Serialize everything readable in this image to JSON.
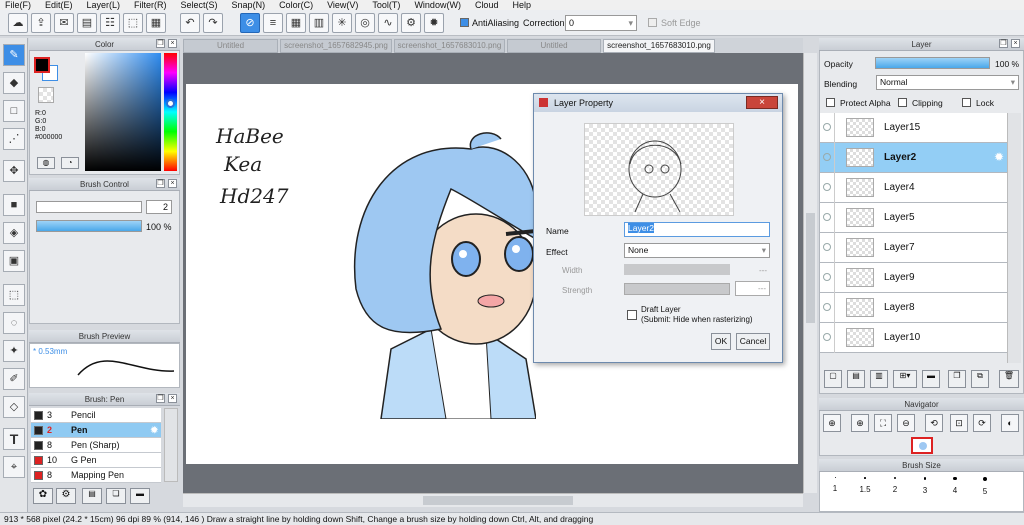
{
  "menu": [
    "File(F)",
    "Edit(E)",
    "Layer(L)",
    "Filter(R)",
    "Select(S)",
    "Snap(N)",
    "Color(C)",
    "View(V)",
    "Tool(T)",
    "Window(W)",
    "Cloud",
    "Help"
  ],
  "toolbar": {
    "antialiasing_label": "AntiAliasing",
    "correction_label": "Correction",
    "correction_value": "0",
    "soft_edge_label": "Soft Edge"
  },
  "color_panel": {
    "title": "Color",
    "r": "R:0",
    "g": "G:0",
    "b": "B:0",
    "hex": "#000000"
  },
  "brush_control": {
    "title": "Brush Control",
    "size": "2",
    "opacity": "100 %",
    "opacity_fill": 1.0
  },
  "brush_preview": {
    "title": "Brush Preview",
    "size": "* 0.53mm"
  },
  "brush_list": {
    "title": "Brush: Pen",
    "items": [
      {
        "size": "3",
        "name": "Pencil",
        "color": "#222222"
      },
      {
        "size": "2",
        "name": "Pen",
        "color": "#222222",
        "selected": true
      },
      {
        "size": "8",
        "name": "Pen (Sharp)",
        "color": "#222222"
      },
      {
        "size": "10",
        "name": "G Pen",
        "color": "#dd2222"
      },
      {
        "size": "8",
        "name": "Mapping Pen",
        "color": "#dd2222"
      }
    ]
  },
  "tabs": [
    "Untitled",
    "screenshot_1657682945.png",
    "screenshot_1657683010.png",
    "Untitled",
    "screenshot_1657683010.png"
  ],
  "active_tab": 4,
  "canvas_text": [
    "HaBee",
    "Kea",
    "Hd247"
  ],
  "dialog": {
    "title": "Layer Property",
    "name_label": "Name",
    "name_value": "Layer2",
    "effect_label": "Effect",
    "effect_value": "None",
    "width_label": "Width",
    "width_dash": "---",
    "strength_label": "Strength",
    "strength_dash": "---",
    "draft_label": "Draft Layer",
    "draft_note": "(Submit: Hide when rasterizing)",
    "ok": "OK",
    "cancel": "Cancel"
  },
  "layer_panel": {
    "title": "Layer",
    "opacity_label": "Opacity",
    "opacity_value": "100 %",
    "opacity_fill": 1.0,
    "blending_label": "Blending",
    "blending_value": "Normal",
    "protect_alpha": "Protect Alpha",
    "clipping": "Clipping",
    "lock": "Lock",
    "layers": [
      "Layer15",
      "Layer2",
      "Layer4",
      "Layer5",
      "Layer7",
      "Layer9",
      "Layer8",
      "Layer10"
    ],
    "selected": "Layer2"
  },
  "navigator": {
    "title": "Navigator"
  },
  "brush_size": {
    "title": "Brush Size",
    "sizes": [
      "1",
      "1.5",
      "2",
      "3",
      "4",
      "5"
    ]
  },
  "status": "913 * 568 pixel  (24.2 * 15cm)  96 dpi  89 %  (914, 146 )   Draw a straight line by holding down Shift, Change a brush size by holding down Ctrl, Alt, and dragging",
  "colors": {
    "accent": "#3d8ee6",
    "selected_row": "#93cef5"
  }
}
